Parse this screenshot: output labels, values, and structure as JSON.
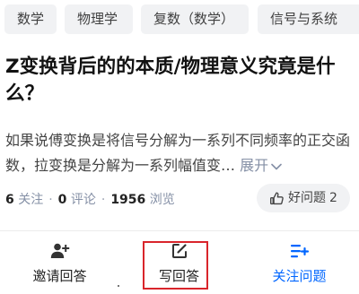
{
  "tags": [
    "数学",
    "物理学",
    "复数（数学）",
    "信号与系统"
  ],
  "question": {
    "title": "Z变换背后的的本质/物理意义究竟是什么？",
    "excerpt": "如果说傅变换是将信号分解为一系列不同频率的正交函数，拉变换是分解为一系列幅值变…",
    "expand_label": "展开"
  },
  "stats": {
    "followers": "6",
    "followers_label": "关注",
    "comments": "0",
    "comments_label": "评论",
    "views": "1956",
    "views_label": "浏览",
    "separator": "·"
  },
  "helpful": {
    "label": "好问题",
    "count": "2"
  },
  "actions": {
    "invite_label": "邀请回答",
    "write_label": "写回答",
    "follow_label": "关注问题"
  },
  "colors": {
    "accent": "#0066ff",
    "highlight": "#d9252b"
  }
}
